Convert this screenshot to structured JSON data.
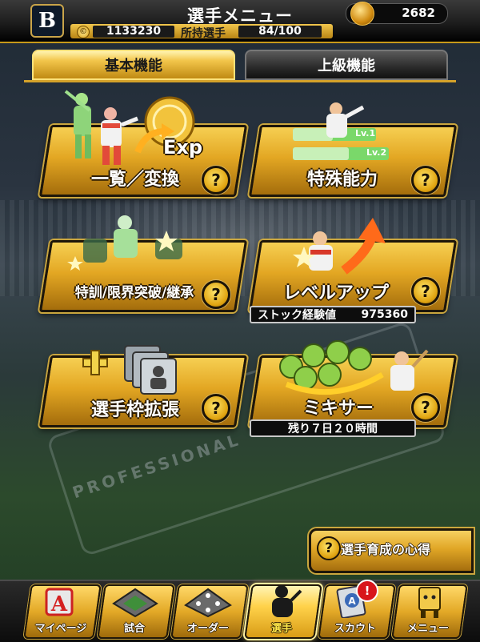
{
  "header": {
    "title": "選手メニュー",
    "team_logo_letter": "B",
    "gold_value": "2682",
    "coin_symbol": "©",
    "coin_value": "1133230",
    "holding_label": "所持選手",
    "holding_value": "84/100"
  },
  "tabs": [
    {
      "label": "基本機能",
      "active": true
    },
    {
      "label": "上級機能",
      "active": false
    }
  ],
  "menu": {
    "list_convert": {
      "label": "一覧／変換",
      "exp_text": "Exp"
    },
    "special_ability": {
      "label": "特殊能力",
      "lv1": "Lv.1",
      "lv2": "Lv.2"
    },
    "training": {
      "label": "特訓/限界突破/継承"
    },
    "level_up": {
      "label": "レベルアップ",
      "stock_label": "ストック経験値",
      "stock_value": "975360"
    },
    "expand": {
      "label": "選手枠拡張"
    },
    "mixer": {
      "label": "ミキサー",
      "remaining": "残り７日２０時間"
    }
  },
  "help_symbol": "?",
  "guide": {
    "label": "選手育成の心得"
  },
  "bottom_nav": [
    {
      "label": "マイページ",
      "icon": "a-logo-icon"
    },
    {
      "label": "試合",
      "icon": "stadium-icon"
    },
    {
      "label": "オーダー",
      "icon": "lineup-icon"
    },
    {
      "label": "選手",
      "icon": "player-icon",
      "active": true
    },
    {
      "label": "スカウト",
      "icon": "scout-card-icon",
      "badge": "!"
    },
    {
      "label": "メニュー",
      "icon": "menu-box-icon"
    }
  ],
  "colors": {
    "gold": "#e3a723",
    "gold_light": "#f6cf52",
    "dark": "#1e1609",
    "alert": "#d8151b"
  }
}
